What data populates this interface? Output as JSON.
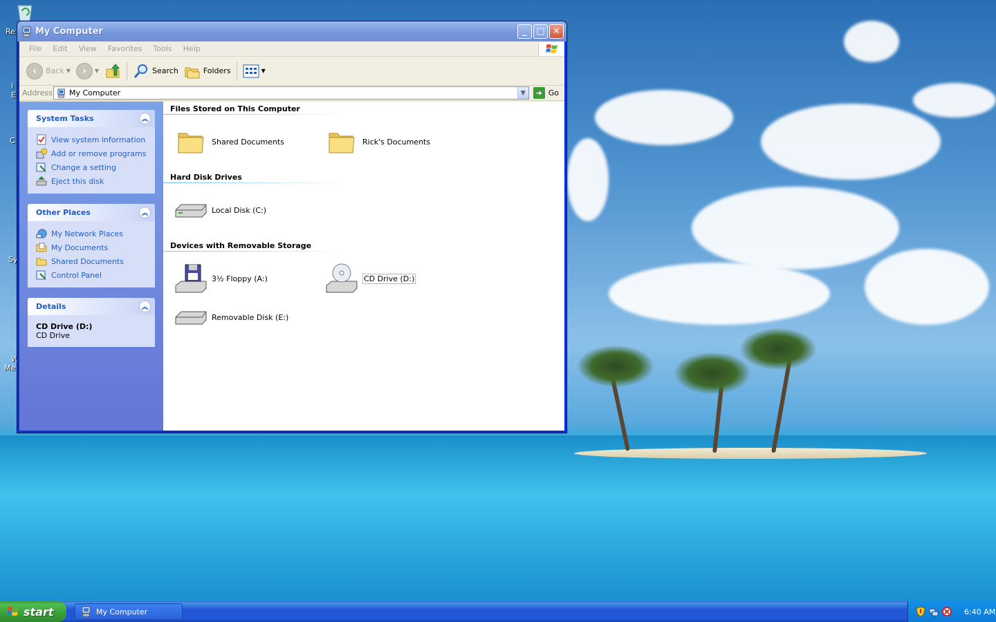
{
  "desktop": {
    "icon_labels": [
      "Re",
      "I",
      "E",
      "C",
      "Sy",
      "W",
      "Me"
    ]
  },
  "window": {
    "title": "My Computer",
    "controls": {
      "minimize": "_",
      "maximize": "□",
      "close": "✕"
    },
    "menu": [
      "File",
      "Edit",
      "View",
      "Favorites",
      "Tools",
      "Help"
    ],
    "toolbar": {
      "back": "Back",
      "search": "Search",
      "folders": "Folders"
    },
    "address": {
      "label": "Address",
      "value": "My Computer",
      "go": "Go"
    },
    "taskpane": {
      "system_tasks": {
        "title": "System Tasks",
        "items": [
          "View system information",
          "Add or remove programs",
          "Change a setting",
          "Eject this disk"
        ]
      },
      "other_places": {
        "title": "Other Places",
        "items": [
          "My Network Places",
          "My Documents",
          "Shared Documents",
          "Control Panel"
        ]
      },
      "details": {
        "title": "Details",
        "name": "CD Drive (D:)",
        "type": "CD Drive"
      }
    },
    "groups": [
      {
        "title": "Files Stored on This Computer",
        "items": [
          "Shared Documents",
          "Rick's Documents"
        ]
      },
      {
        "title": "Hard Disk Drives",
        "items": [
          "Local Disk (C:)"
        ]
      },
      {
        "title": "Devices with Removable Storage",
        "items": [
          "3½ Floppy (A:)",
          "CD Drive (D:)",
          "Removable Disk (E:)"
        ]
      }
    ]
  },
  "taskbar": {
    "start": "start",
    "task": "My Computer",
    "clock": "6:40 AM"
  },
  "colors": {
    "title_bar": "#7595dd",
    "task_link": "#215dc6",
    "taskbar": "#2157d7",
    "start_button": "#3a9d3a"
  }
}
